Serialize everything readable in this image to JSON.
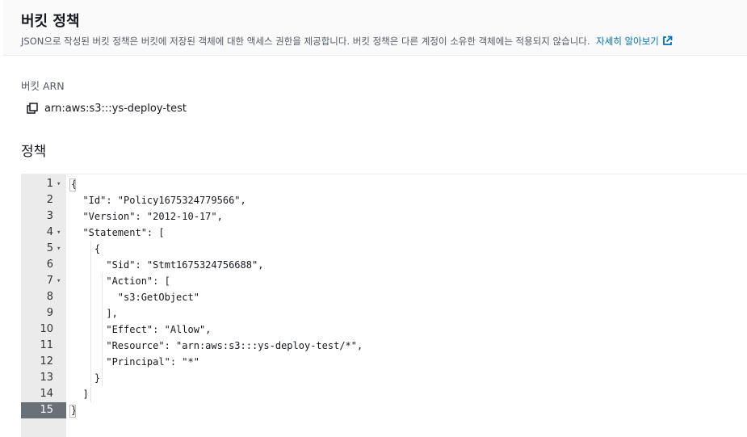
{
  "header": {
    "title": "버킷 정책",
    "description": "JSON으로 작성된 버킷 정책은 버킷에 저장된 객체에 대한 액세스 권한을 제공합니다. 버킷 정책은 다른 계정이 소유한 객체에는 적용되지 않습니다.",
    "learn_more": "자세히 알아보기",
    "learn_more_icon": "external-link-icon"
  },
  "arn": {
    "label": "버킷 ARN",
    "value": "arn:aws:s3:::ys-deploy-test",
    "copy_icon": "copy-icon"
  },
  "policy": {
    "title": "정책",
    "active_line": 15,
    "lines": [
      {
        "n": "1",
        "fold": true,
        "text": "{"
      },
      {
        "n": "2",
        "fold": false,
        "text": "  \"Id\": \"Policy1675324779566\","
      },
      {
        "n": "3",
        "fold": false,
        "text": "  \"Version\": \"2012-10-17\","
      },
      {
        "n": "4",
        "fold": true,
        "text": "  \"Statement\": ["
      },
      {
        "n": "5",
        "fold": true,
        "text": "    {"
      },
      {
        "n": "6",
        "fold": false,
        "text": "      \"Sid\": \"Stmt1675324756688\","
      },
      {
        "n": "7",
        "fold": true,
        "text": "      \"Action\": ["
      },
      {
        "n": "8",
        "fold": false,
        "text": "        \"s3:GetObject\""
      },
      {
        "n": "9",
        "fold": false,
        "text": "      ],"
      },
      {
        "n": "10",
        "fold": false,
        "text": "      \"Effect\": \"Allow\","
      },
      {
        "n": "11",
        "fold": false,
        "text": "      \"Resource\": \"arn:aws:s3:::ys-deploy-test/*\","
      },
      {
        "n": "12",
        "fold": false,
        "text": "      \"Principal\": \"*\""
      },
      {
        "n": "13",
        "fold": false,
        "text": "    }"
      },
      {
        "n": "14",
        "fold": false,
        "text": "  ]"
      },
      {
        "n": "15",
        "fold": false,
        "text": "}"
      }
    ]
  }
}
